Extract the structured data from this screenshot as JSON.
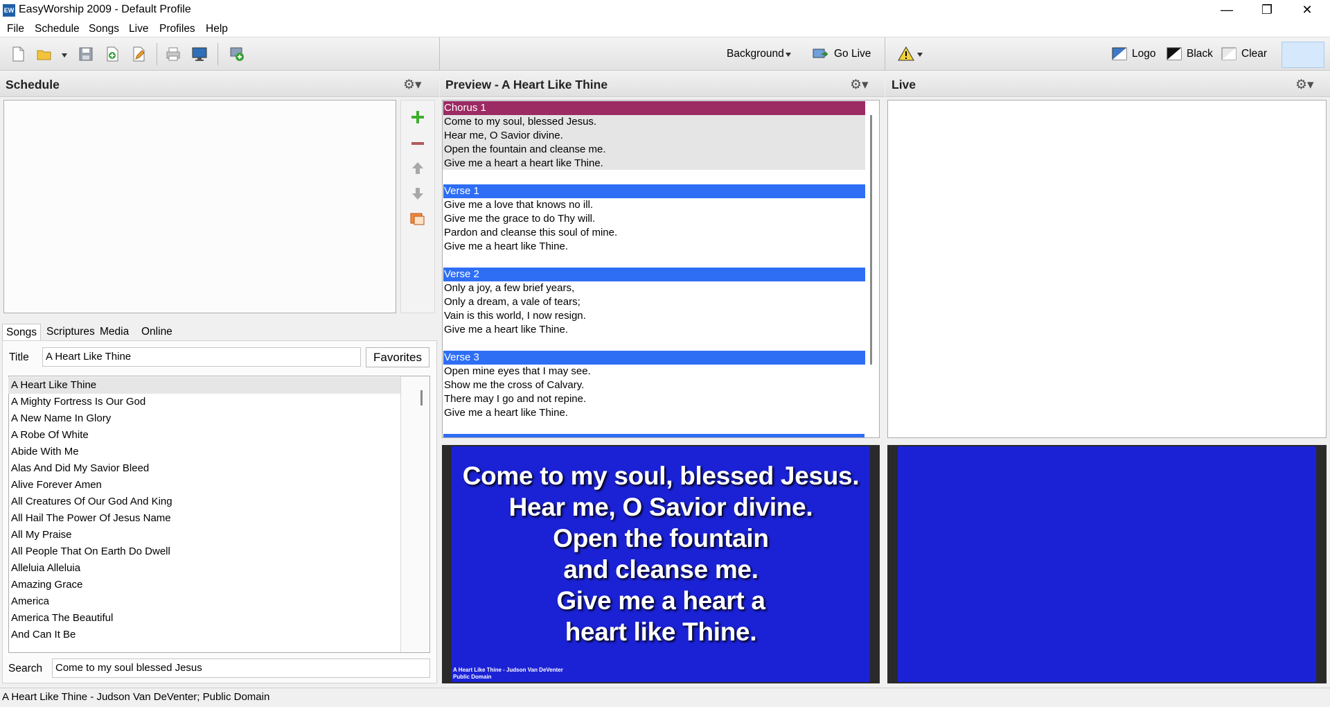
{
  "window": {
    "title": "EasyWorship 2009 - Default Profile",
    "app_icon_text": "EW",
    "minimize": "—",
    "restore": "❐",
    "close": "✕"
  },
  "menu": [
    "File",
    "Schedule",
    "Songs",
    "Live",
    "Profiles",
    "Help"
  ],
  "toolbar": {
    "background_label": "Background",
    "go_live_label": "Go Live",
    "logo_label": "Logo",
    "black_label": "Black",
    "clear_label": "Clear"
  },
  "schedule": {
    "title": "Schedule"
  },
  "tabs": [
    "Songs",
    "Scriptures",
    "Media",
    "Online"
  ],
  "songs": {
    "title_label": "Title",
    "title_value": "A Heart Like Thine",
    "favorites_label": "Favorites",
    "list": [
      "A Heart Like Thine",
      "A Mighty Fortress Is Our God",
      "A New Name In Glory",
      "A Robe Of White",
      "Abide With Me",
      "Alas And Did My Savior Bleed",
      "Alive Forever Amen",
      "All Creatures Of Our God And King",
      "All Hail The Power Of Jesus Name",
      "All My Praise",
      "All People That On Earth Do Dwell",
      "Alleluia Alleluia",
      "Amazing Grace",
      "America",
      "America The Beautiful",
      "And Can It Be"
    ],
    "search_label": "Search",
    "search_value": "Come to my soul blessed Jesus"
  },
  "preview": {
    "title": "Preview - A Heart Like Thine",
    "sections": [
      {
        "name": "Chorus 1",
        "color": "#9c2a63",
        "lines": [
          "Come to my soul, blessed Jesus.",
          "Hear me, O Savior divine.",
          "Open the fountain and cleanse me.",
          "Give me a heart a heart like Thine."
        ]
      },
      {
        "name": "Verse 1",
        "color": "#2e6ef5",
        "lines": [
          "Give me a love that knows no ill.",
          "Give me the grace to do Thy will.",
          "Pardon and cleanse this soul of mine.",
          "Give me a heart like Thine."
        ]
      },
      {
        "name": "Verse 2",
        "color": "#2e6ef5",
        "lines": [
          "Only a joy, a few brief years,",
          "Only a dream, a vale of tears;",
          "Vain is this world, I now resign.",
          "Give me a heart like Thine."
        ]
      },
      {
        "name": "Verse 3",
        "color": "#2e6ef5",
        "lines": [
          "Open mine eyes that I may see.",
          "Show me the cross of Calvary.",
          "There may I go and not repine.",
          "Give me a heart like Thine."
        ]
      }
    ],
    "slide_lines": [
      "Come to my soul, blessed Jesus.",
      "Hear me, O Savior divine.",
      "Open the fountain",
      "and cleanse me.",
      "Give me a heart a",
      "heart like Thine."
    ],
    "slide_footer_1": "A Heart Like Thine - Judson Van DeVenter",
    "slide_footer_2": "Public Domain"
  },
  "live": {
    "title": "Live"
  },
  "status": {
    "text": "A Heart Like Thine - Judson Van DeVenter; Public Domain"
  },
  "colors": {
    "chorus": "#9c2a63",
    "verse": "#2e6ef5",
    "slide_bg": "#1b22d6"
  }
}
